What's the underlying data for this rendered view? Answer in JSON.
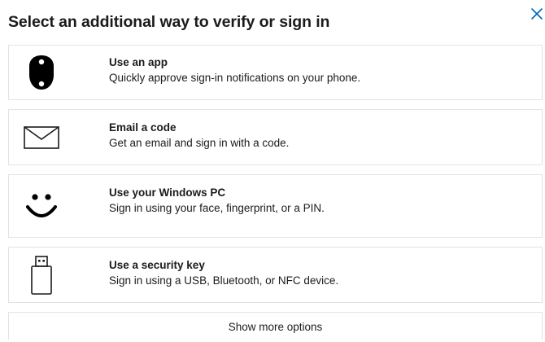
{
  "dialog": {
    "title": "Select an additional way to verify or sign in",
    "close_icon": "close-icon",
    "accent_color": "#0067b8"
  },
  "options": [
    {
      "icon": "phone-app-icon",
      "title": "Use an app",
      "description": "Quickly approve sign-in notifications on your phone."
    },
    {
      "icon": "envelope-icon",
      "title": "Email a code",
      "description": "Get an email and sign in with a code."
    },
    {
      "icon": "windows-hello-face-icon",
      "title": "Use your Windows PC",
      "description": "Sign in using your face, fingerprint, or a PIN."
    },
    {
      "icon": "usb-security-key-icon",
      "title": "Use a security key",
      "description": "Sign in using a USB, Bluetooth, or NFC device."
    }
  ],
  "more_options": {
    "label": "Show more options"
  }
}
